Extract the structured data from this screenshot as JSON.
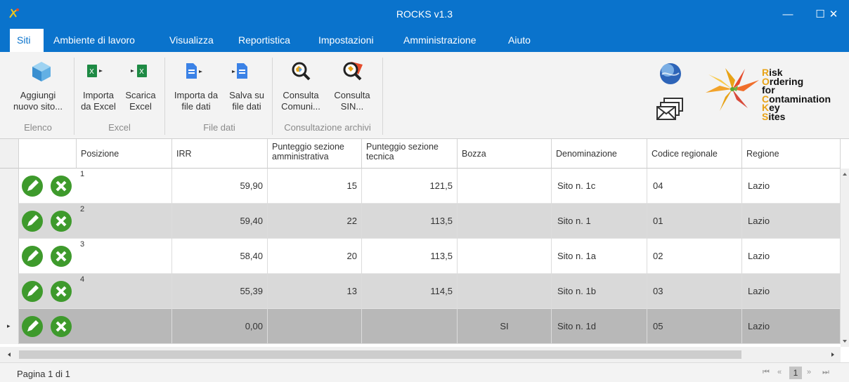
{
  "window": {
    "title": "ROCKS   v1.3",
    "minimize_glyph": "—",
    "maximize_glyph": "☐",
    "close_glyph": "✕"
  },
  "menu": [
    "Siti",
    "Ambiente di lavoro",
    "Visualizza",
    "Reportistica",
    "Impostazioni",
    "Amministrazione",
    "Aiuto"
  ],
  "ribbon": {
    "buttons": {
      "add_site": {
        "line1": "Aggiungi",
        "line2": "nuovo sito..."
      },
      "import_excel": {
        "line1": "Importa",
        "line2": "da Excel"
      },
      "download_excel": {
        "line1": "Scarica",
        "line2": "Excel"
      },
      "import_file": {
        "line1": "Importa da",
        "line2": "file dati"
      },
      "save_file": {
        "line1": "Salva su",
        "line2": "file dati"
      },
      "consult_comuni": {
        "line1": "Consulta",
        "line2": "Comuni..."
      },
      "consult_sin": {
        "line1": "Consulta",
        "line2": "SIN..."
      }
    },
    "groups": {
      "elenco": "Elenco",
      "excel": "Excel",
      "file_dati": "File dati",
      "consultazione": "Consultazione archivi"
    },
    "brand_lines": [
      {
        "first": "R",
        "rest": "isk"
      },
      {
        "first": "O",
        "rest": "rdering"
      },
      {
        "first": "",
        "rest": "for"
      },
      {
        "first": "C",
        "rest": "ontamination"
      },
      {
        "first": "K",
        "rest": "ey"
      },
      {
        "first": "S",
        "rest": "ites"
      }
    ],
    "icons": [
      "cube-icon",
      "excel-import-icon",
      "excel-export-icon",
      "file-import-icon",
      "file-save-icon",
      "search-map-icon",
      "search-sin-icon",
      "globe-icon",
      "mail-icon",
      "rocks-logo-icon"
    ]
  },
  "grid": {
    "columns": {
      "posizione": "Posizione",
      "irr": "IRR",
      "punt_amm": "Punteggio sezione amministrativa",
      "punt_tec": "Punteggio sezione tecnica",
      "bozza": "Bozza",
      "denominazione": "Denominazione",
      "codice": "Codice regionale",
      "regione": "Regione"
    },
    "rows": [
      {
        "posizione": "1",
        "irr": "59,90",
        "punt_amm": "15",
        "punt_tec": "121,5",
        "bozza": "",
        "denominazione": "Sito n. 1c",
        "codice": "04",
        "regione": "Lazio"
      },
      {
        "posizione": "2",
        "irr": "59,40",
        "punt_amm": "22",
        "punt_tec": "113,5",
        "bozza": "",
        "denominazione": "Sito n. 1",
        "codice": "01",
        "regione": "Lazio"
      },
      {
        "posizione": "3",
        "irr": "58,40",
        "punt_amm": "20",
        "punt_tec": "113,5",
        "bozza": "",
        "denominazione": "Sito n. 1a",
        "codice": "02",
        "regione": "Lazio"
      },
      {
        "posizione": "4",
        "irr": "55,39",
        "punt_amm": "13",
        "punt_tec": "114,5",
        "bozza": "",
        "denominazione": "Sito n. 1b",
        "codice": "03",
        "regione": "Lazio"
      },
      {
        "posizione": "",
        "irr": "0,00",
        "punt_amm": "",
        "punt_tec": "",
        "bozza": "SI",
        "denominazione": "Sito n. 1d",
        "codice": "05",
        "regione": "Lazio"
      }
    ],
    "current_row_marker": "▸"
  },
  "status": {
    "page_label": "Pagina 1 di 1",
    "current_page": "1",
    "nav_first": "⏮",
    "nav_prev": "«",
    "nav_next": "»",
    "nav_last": "⏭"
  },
  "colors": {
    "titlebar": "#0a73cc",
    "edit_button": "#3e9a2c",
    "delete_button": "#3e9a2c"
  }
}
